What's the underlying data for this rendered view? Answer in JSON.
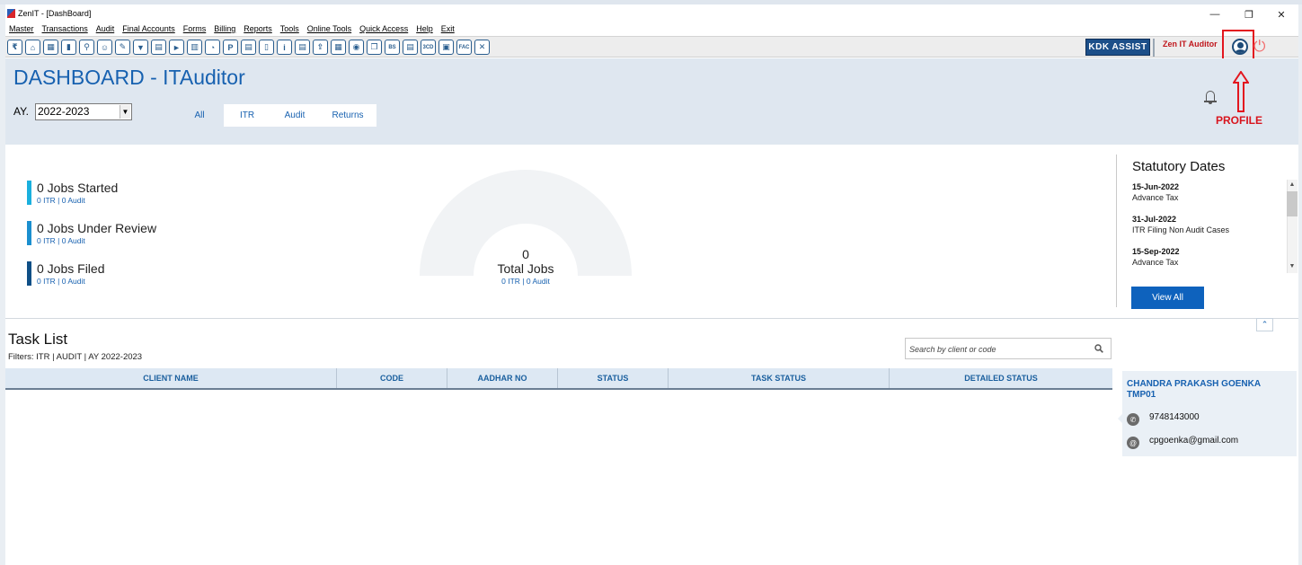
{
  "window": {
    "title": "ZenIT - [DashBoard]",
    "minimize": "—",
    "restore": "❐",
    "close": "✕"
  },
  "menu": [
    "Master",
    "Transactions",
    "Audit",
    "Final Accounts",
    "Forms",
    "Billing",
    "Reports",
    "Tools",
    "Online Tools",
    "Quick Access",
    "Help",
    "Exit"
  ],
  "toolbar": {
    "icons": [
      "rupee-icon",
      "home-icon",
      "building-icon",
      "bar-chart-icon",
      "tree-icon",
      "group-icon",
      "pin-icon",
      "filter-icon",
      "tax-icon",
      "play-icon",
      "calculator-icon",
      "pie-icon",
      "pay-icon",
      "ledger-icon",
      "book-icon",
      "info-icon",
      "sheet-icon",
      "upload-icon",
      "calendar-icon",
      "chat-icon",
      "copy-icon",
      "bs-icon",
      "stack-icon",
      "3cd-icon",
      "image-icon",
      "fac-icon",
      "close-circle-icon"
    ],
    "icon_glyphs": [
      "₹",
      "⌂",
      "▦",
      "▮",
      "⚲",
      "☺",
      "✎",
      "▼",
      "▤",
      "►",
      "▥",
      "◔",
      "P",
      "▤",
      "▯",
      "i",
      "▤",
      "⇪",
      "▦",
      "◉",
      "❐",
      "BS",
      "▤",
      "3CD",
      "▣",
      "FAC",
      "✕"
    ],
    "kdk_assist": "KDK ASSIST",
    "zen_label": "Zen IT Auditor",
    "power_glyph": "⏻"
  },
  "header": {
    "title": "DASHBOARD - ITAuditor",
    "ay_label": "AY.",
    "ay_value": "2022-2023",
    "ay_arrow": "▼",
    "tabs": [
      "All",
      "ITR",
      "Audit",
      "Returns"
    ],
    "active_tab": "All",
    "profile_caption": "PROFILE"
  },
  "stats": [
    {
      "title": "0 Jobs Started",
      "sub": "0 ITR | 0 Audit",
      "color": "#1ab0de"
    },
    {
      "title": "0 Jobs Under Review",
      "sub": "0 ITR | 0 Audit",
      "color": "#1b8fcf"
    },
    {
      "title": "0 Jobs Filed",
      "sub": "0 ITR | 0 Audit",
      "color": "#0f4f86"
    }
  ],
  "gauge": {
    "value": "0",
    "label": "Total Jobs",
    "sub": "0 ITR | 0 Audit"
  },
  "statutory": {
    "heading": "Statutory Dates",
    "items": [
      {
        "date": "15-Jun-2022",
        "event": "Advance Tax"
      },
      {
        "date": "31-Jul-2022",
        "event": "ITR Filing Non Audit Cases"
      },
      {
        "date": "15-Sep-2022",
        "event": "Advance Tax"
      }
    ],
    "view_all": "View All",
    "scroll_up": "▲",
    "scroll_down": "▼"
  },
  "collapse_glyph": "⌃",
  "task_list": {
    "title": "Task List",
    "filters": "Filters: ITR | AUDIT | AY 2022-2023",
    "search_placeholder": "Search by client or code",
    "columns": [
      "CLIENT NAME",
      "CODE",
      "AADHAR NO",
      "STATUS",
      "TASK STATUS",
      "DETAILED STATUS"
    ]
  },
  "contact": {
    "name": "CHANDRA PRAKASH GOENKA",
    "code": "TMP01",
    "phone": "9748143000",
    "email": "cpgoenka@gmail.com",
    "phone_glyph": "✆",
    "email_glyph": "@"
  }
}
